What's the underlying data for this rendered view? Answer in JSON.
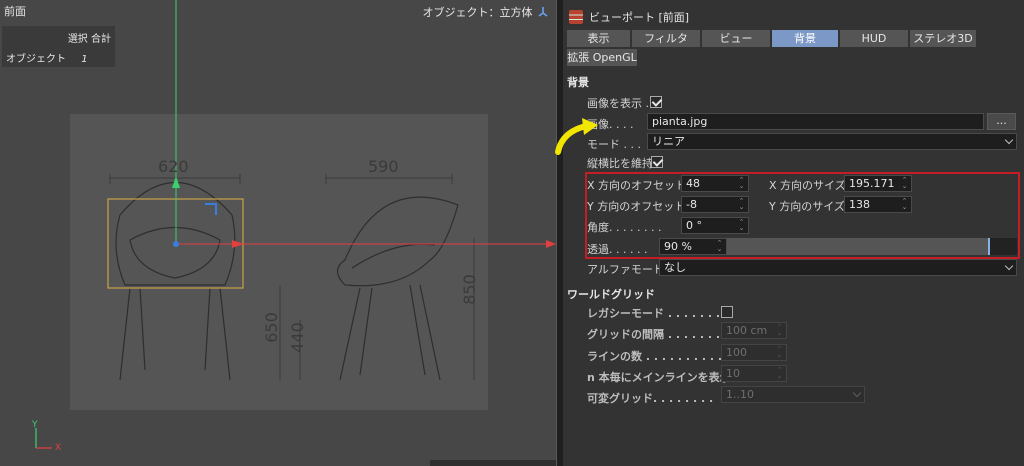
{
  "viewport": {
    "label": "前面",
    "hud_header": "選択 合計",
    "hud_row_label": "オブジェクト",
    "hud_row_value": "1",
    "object_label": "オブジェクト：立方体",
    "dims": {
      "top_left": "620",
      "top_right": "590",
      "left_h1": "650",
      "left_h2": "440",
      "right_h": "850"
    },
    "axes": {
      "y": "Y",
      "x": "X"
    }
  },
  "panel": {
    "title": "ビューポート [前面]",
    "tabs": [
      "表示",
      "フィルタ",
      "ビュー",
      "背景",
      "HUD",
      "ステレオ3D"
    ],
    "active_tab": "背景",
    "tab_row2": "拡張 OpenGL",
    "section_background": "背景",
    "show_image_label": "画像を表示 .",
    "show_image_checked": true,
    "image_label": "画像. . . .",
    "image_value": "pianta.jpg",
    "browse_label": "...",
    "mode_label": "モード . . .",
    "mode_value": "リニア",
    "keep_aspect_label": "縦横比を維持",
    "keep_aspect_checked": true,
    "x_offset_label": "X 方向のオフセット",
    "x_offset_value": "48",
    "x_size_label": "X 方向のサイズ",
    "x_size_value": "195.171",
    "y_offset_label": "Y 方向のオフセット",
    "y_offset_value": "-8",
    "y_size_label": "Y 方向のサイズ",
    "y_size_value": "138",
    "angle_label": "角度. . . . . . . .",
    "angle_value": "0 °",
    "transparency_label": "透過. . . . . .",
    "transparency_value": "90 %",
    "transparency_fraction": 0.9,
    "alpha_mode_label": "アルファモード",
    "alpha_mode_value": "なし",
    "section_world_grid": "ワールドグリッド",
    "legacy_mode_label": "レガシーモード . . . . . . .",
    "legacy_mode_checked": false,
    "grid_spacing_label": "グリッドの間隔 . . . . . . . .",
    "grid_spacing_value": "100 cm",
    "line_count_label": "ラインの数 . . . . . . . . . .",
    "line_count_value": "100",
    "main_line_label": "n 本毎にメインラインを表示",
    "main_line_value": "10",
    "dynamic_grid_label": "可変グリッド. . . . . . . .",
    "dynamic_grid_value": "1..10"
  },
  "colors": {
    "highlight_box": "#c41e24",
    "annotation_arrow": "#f2e600",
    "active_tab": "#7c98c6"
  }
}
